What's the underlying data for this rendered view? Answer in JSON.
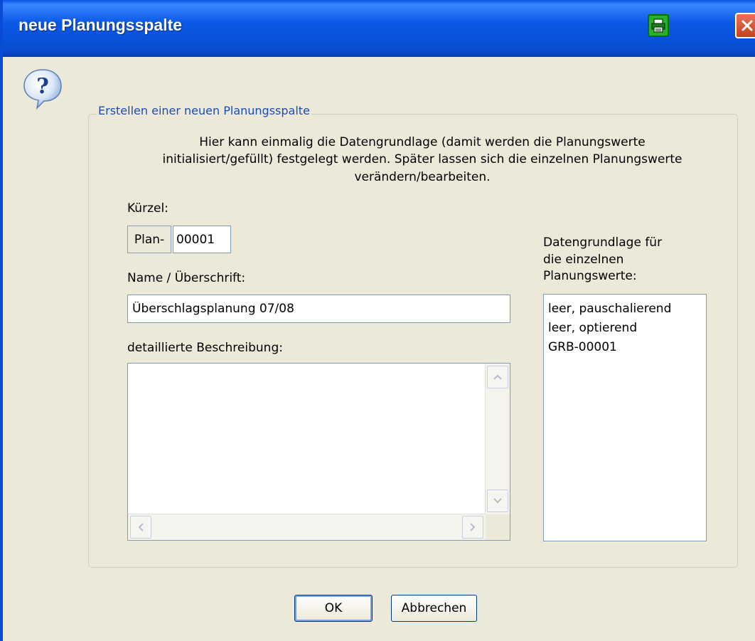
{
  "window": {
    "title": "neue Planungsspalte"
  },
  "titlebar": {
    "print_icon": "printer-icon",
    "close_icon": "close-icon",
    "close_color": "#d6502e",
    "print_color": "#25b12a"
  },
  "dialog": {
    "icon": "question-icon",
    "group_title": "Erstellen einer neuen Planungsspalte",
    "description_lines": [
      "Hier kann einmalig die Datengrundlage (damit werden die Planungswerte",
      "initialisiert/gefüllt) festgelegt werden. Später lassen sich die einzelnen Planungswerte",
      "verändern/bearbeiten."
    ]
  },
  "form": {
    "kuerzel_label": "Kürzel:",
    "kuerzel_prefix": "Plan-",
    "kuerzel_value": "00001",
    "name_label": "Name / Überschrift:",
    "name_value": "Überschlagsplanung 07/08",
    "description_label": "detaillierte Beschreibung:",
    "description_value": ""
  },
  "datasource": {
    "label_lines": [
      "Datengrundlage für",
      "die einzelnen",
      "Planungswerte:"
    ],
    "options": [
      "leer, pauschalierend",
      "leer, optierend",
      "GRB-00001"
    ]
  },
  "buttons": {
    "ok_label": "OK",
    "cancel_label": "Abbrechen"
  }
}
